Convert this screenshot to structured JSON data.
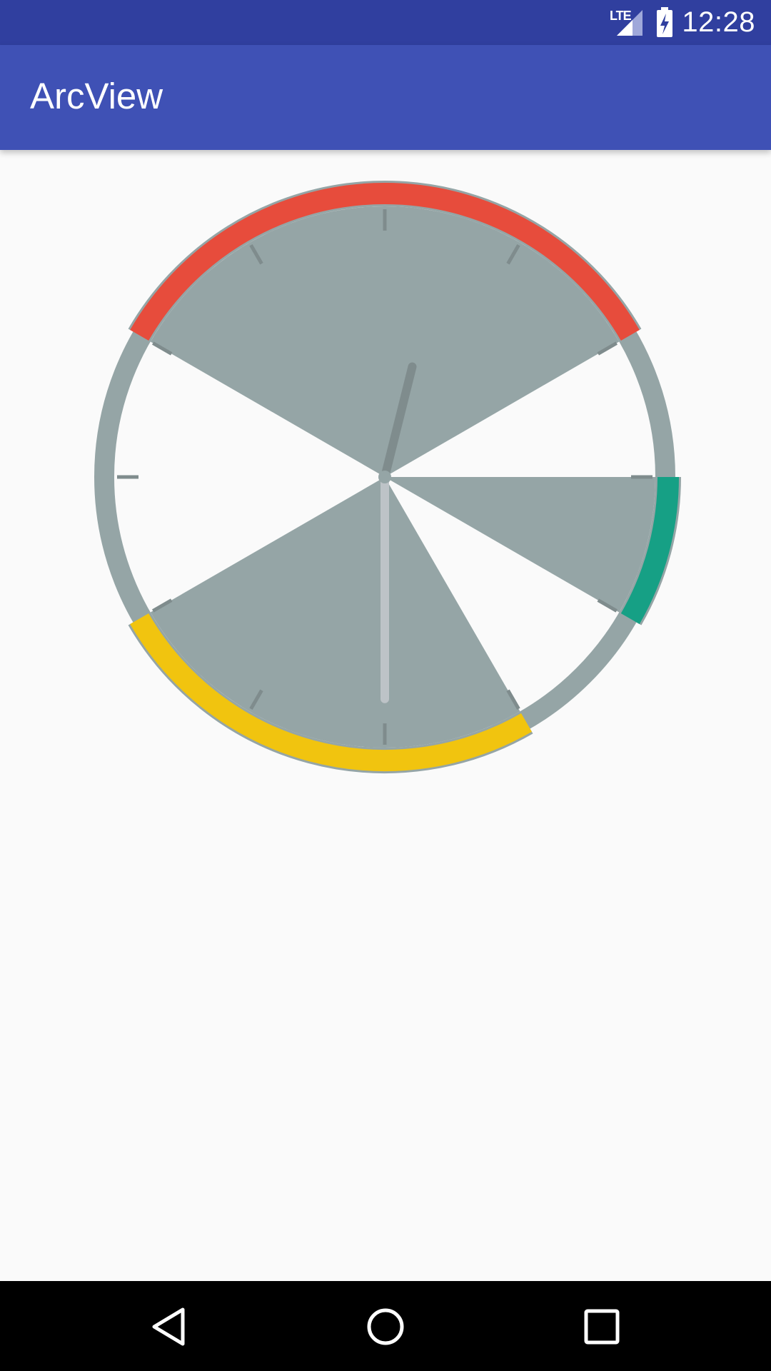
{
  "status_bar": {
    "time": "12:28",
    "network_label": "LTE",
    "icons": [
      "lte-icon",
      "signal-icon",
      "battery-charging-icon"
    ],
    "color": "#303F9F"
  },
  "app_bar": {
    "title": "ArcView",
    "color": "#3F51B5"
  },
  "arc_view": {
    "ring_color": "#95A5A6",
    "tick_color": "#7F8C8D",
    "tick_count": 12,
    "sectors": [
      {
        "id": "top",
        "start_deg": 300,
        "end_deg": 60,
        "color": "#E74C3C"
      },
      {
        "id": "right",
        "start_deg": 90,
        "end_deg": 120,
        "color": "#16A085"
      },
      {
        "id": "bottom",
        "start_deg": 150,
        "end_deg": 240,
        "color": "#F1C40F"
      }
    ],
    "hands": [
      {
        "id": "hour-hand",
        "angle_deg": 14,
        "length_fraction": 0.42,
        "color": "#7F8C8D"
      },
      {
        "id": "minute-hand",
        "angle_deg": 180,
        "length_fraction": 0.82,
        "color": "#BDC3C7"
      }
    ]
  },
  "nav_bar": {
    "buttons": [
      "back-icon",
      "home-icon",
      "recents-icon"
    ]
  }
}
